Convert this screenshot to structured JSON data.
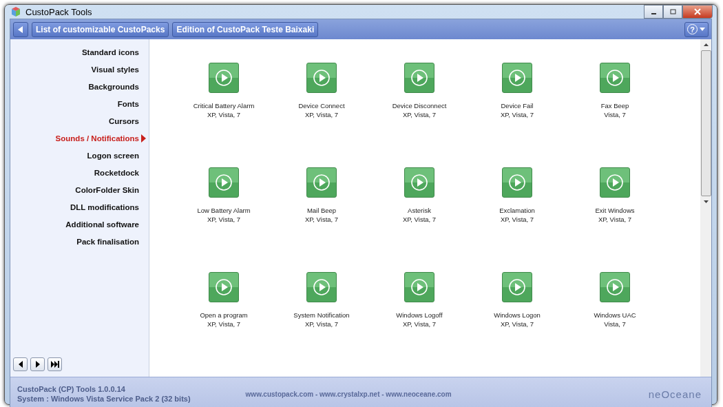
{
  "window": {
    "title": "CustoPack Tools"
  },
  "help": {
    "label": "?"
  },
  "breadcrumbs": [
    {
      "label": "List of customizable CustoPacks"
    },
    {
      "label": "Edition of CustoPack Teste Baixaki"
    }
  ],
  "sidebar": {
    "items": [
      {
        "label": "Standard icons",
        "selected": false
      },
      {
        "label": "Visual styles",
        "selected": false
      },
      {
        "label": "Backgrounds",
        "selected": false
      },
      {
        "label": "Fonts",
        "selected": false
      },
      {
        "label": "Cursors",
        "selected": false
      },
      {
        "label": "Sounds / Notifications",
        "selected": true
      },
      {
        "label": "Logon screen",
        "selected": false
      },
      {
        "label": "Rocketdock",
        "selected": false
      },
      {
        "label": "ColorFolder Skin",
        "selected": false
      },
      {
        "label": "DLL modifications",
        "selected": false
      },
      {
        "label": "Additional software",
        "selected": false
      },
      {
        "label": "Pack finalisation",
        "selected": false
      }
    ]
  },
  "sounds": [
    {
      "name": "Critical Battery Alarm",
      "systems": "XP, Vista, 7"
    },
    {
      "name": "Device Connect",
      "systems": "XP, Vista, 7"
    },
    {
      "name": "Device Disconnect",
      "systems": "XP, Vista, 7"
    },
    {
      "name": "Device Fail",
      "systems": "XP, Vista, 7"
    },
    {
      "name": "Fax Beep",
      "systems": "Vista, 7"
    },
    {
      "name": "Low Battery Alarm",
      "systems": "XP, Vista, 7"
    },
    {
      "name": "Mail Beep",
      "systems": "XP, Vista, 7"
    },
    {
      "name": "Asterisk",
      "systems": "XP, Vista, 7"
    },
    {
      "name": "Exclamation",
      "systems": "XP, Vista, 7"
    },
    {
      "name": "Exit Windows",
      "systems": "XP, Vista, 7"
    },
    {
      "name": "Open a program",
      "systems": "XP, Vista, 7"
    },
    {
      "name": "System Notification",
      "systems": "XP, Vista, 7"
    },
    {
      "name": "Windows Logoff",
      "systems": "XP, Vista, 7"
    },
    {
      "name": "Windows Logon",
      "systems": "XP, Vista, 7"
    },
    {
      "name": "Windows UAC",
      "systems": "Vista, 7"
    }
  ],
  "status_bar": {
    "version": "CustoPack (CP) Tools 1.0.0.14",
    "system": "System : Windows Vista Service Pack 2 (32 bits)",
    "links": "www.custopack.com - www.crystalxp.net - www.neoceane.com",
    "logo": "neOceane"
  }
}
